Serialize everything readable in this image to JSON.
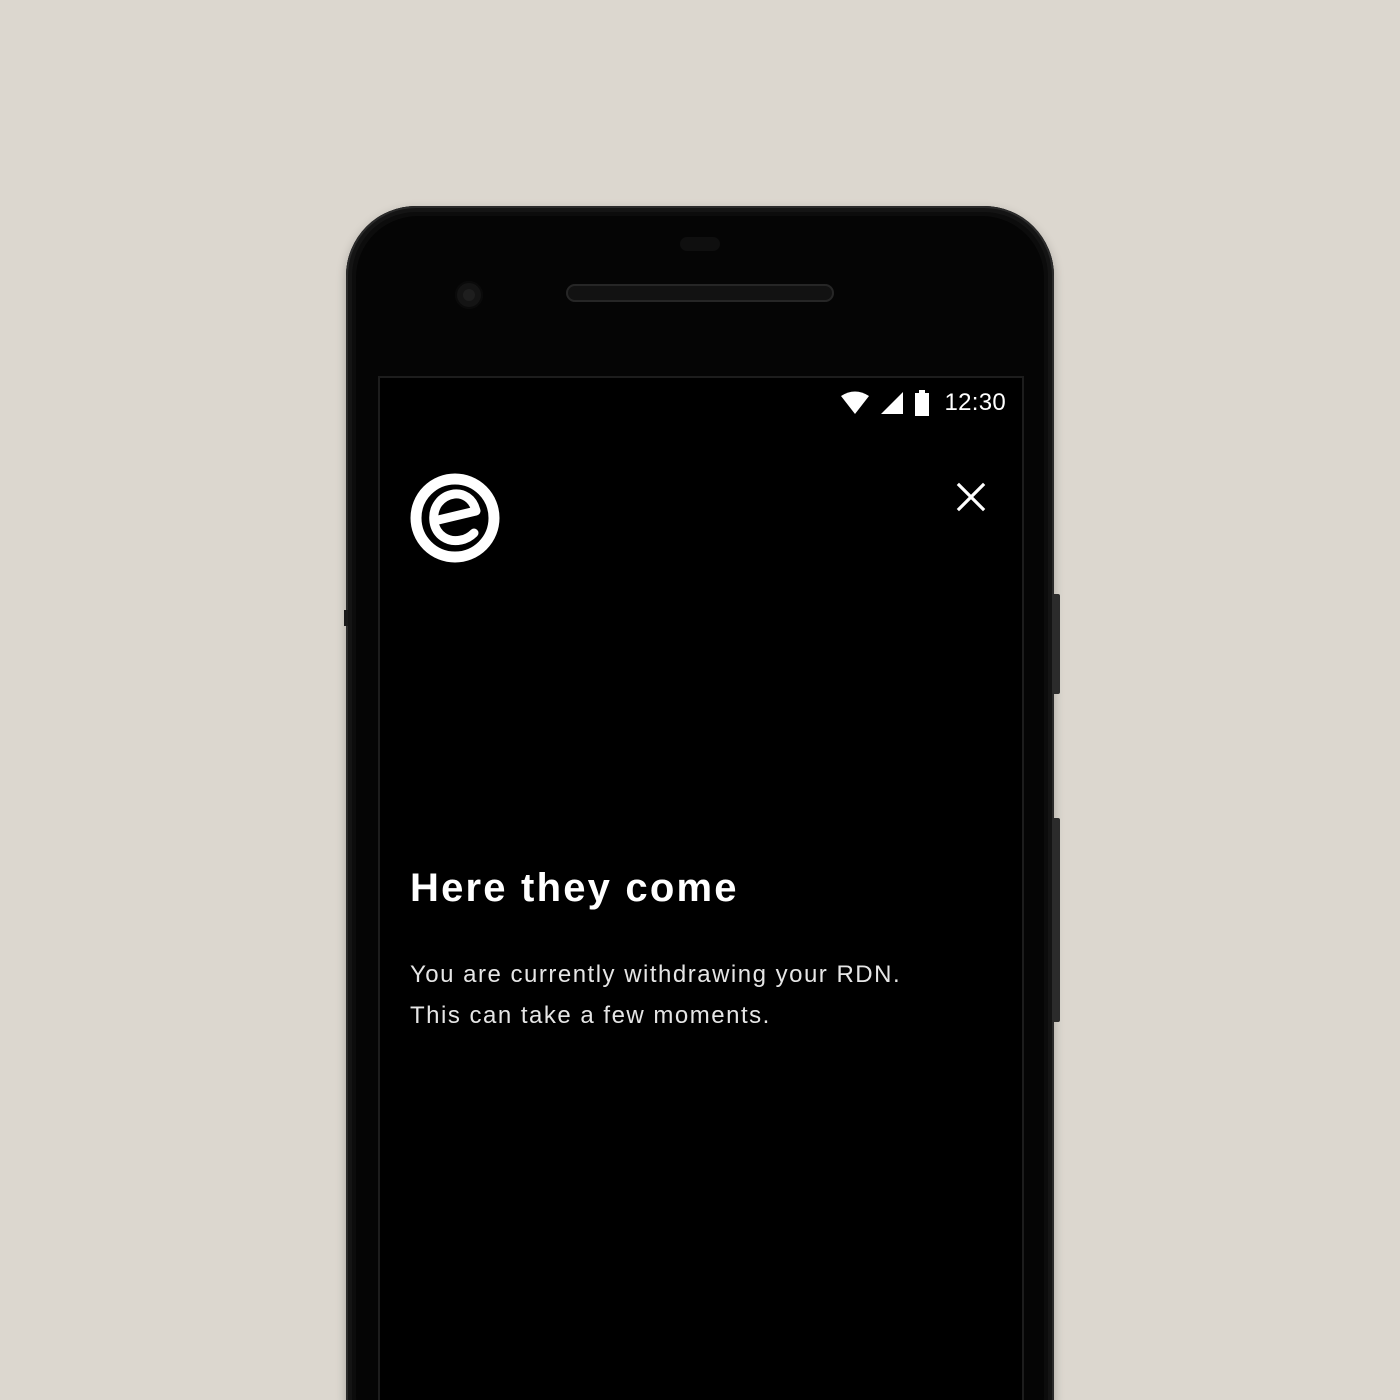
{
  "status_bar": {
    "time": "12:30",
    "icons": [
      "wifi-icon",
      "cellular-signal-icon",
      "battery-icon"
    ]
  },
  "header": {
    "logo_icon": "circle-e-logo-icon",
    "close_icon": "close-icon"
  },
  "content": {
    "title": "Here they come",
    "message_line_1": "You are currently withdrawing your RDN.",
    "message_line_2": "This can take a few moments."
  },
  "colors": {
    "background": "#dcd7cf",
    "screen": "#000000",
    "text": "#ffffff"
  }
}
